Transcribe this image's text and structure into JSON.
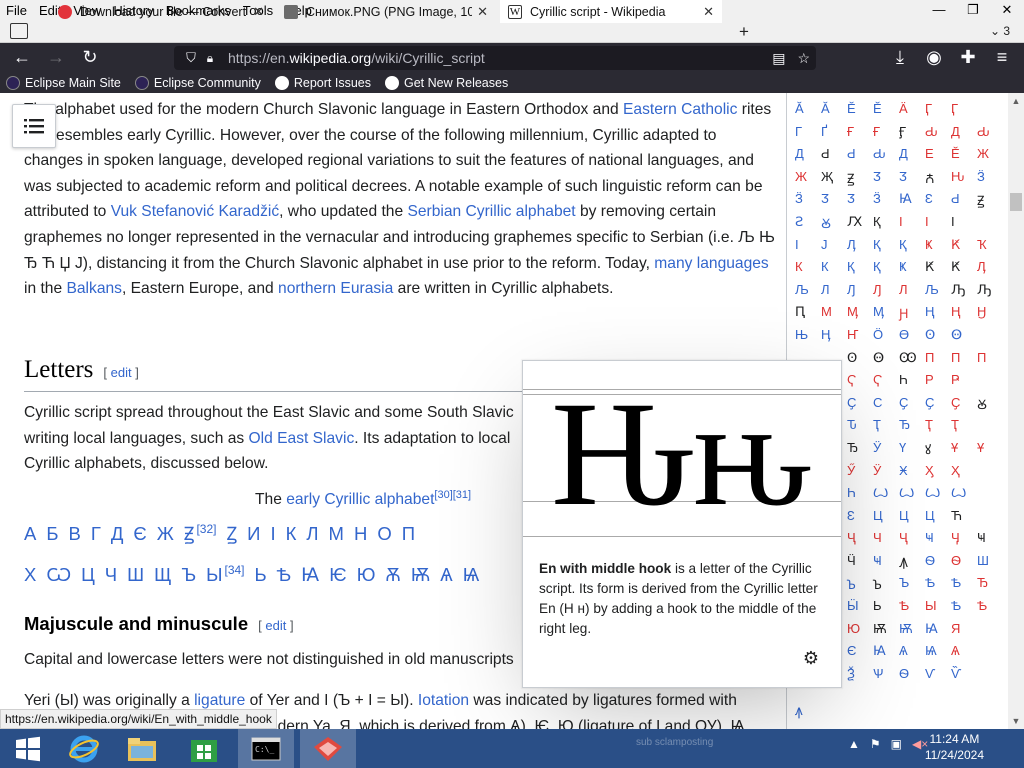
{
  "menubar": {
    "items": [
      "File",
      "Edit",
      "View",
      "History",
      "Bookmarks",
      "Tools",
      "Help"
    ],
    "accels": [
      "F",
      "E",
      "V",
      "s",
      "B",
      "T",
      "H"
    ]
  },
  "window_controls": {
    "minimize": "—",
    "restore": "❐",
    "close": "✕"
  },
  "tabs": [
    {
      "title": "Download your file — Convertic",
      "favicon_color": "#e2333b",
      "close": "✕"
    },
    {
      "title": "Снимок.PNG (PNG Image, 1026",
      "favicon_color": "#6b6b6b",
      "close": "✕"
    },
    {
      "title": "Cyrillic script - Wikipedia",
      "favicon_color": "#ffffff",
      "favicon_glyph": "W",
      "close": "✕"
    }
  ],
  "newtab": "+",
  "tab_count": "⌄ 3",
  "nav": {
    "back": "←",
    "forward": "→",
    "reload": "↻",
    "url_prefix": "https://en.",
    "url_domain": "wikipedia.org",
    "url_path": "/wiki/Cyrillic_script",
    "reader": "▤",
    "star": "☆",
    "download": "⤓",
    "account": "◉",
    "extensions": "✚",
    "menu": "≡"
  },
  "bookmarks": [
    {
      "label": "Eclipse Main Site",
      "icon_color": "#2c2255"
    },
    {
      "label": "Eclipse Community",
      "icon_color": "#2c2255"
    },
    {
      "label": "Report Issues",
      "icon_color": "#ffffff"
    },
    {
      "label": "Get New Releases",
      "icon_color": "#ffffff"
    }
  ],
  "article": {
    "p1": {
      "t1": "The alphabet used for the modern Church Slavonic language in Eastern Orthodox and ",
      "l1": "Eastern Catholic",
      "t2": " rites still resembles early Cyrillic. However, over the course of the following millennium, Cyrillic adapted to changes in spoken language, developed regional variations to suit the features of national languages, and was subjected to academic reform and political decrees. A notable example of such linguistic reform can be attributed to ",
      "l2": "Vuk Stefanović Karadžić",
      "t3": ", who updated the ",
      "l3": "Serbian Cyrillic alphabet",
      "t4": " by removing certain graphemes no longer represented in the vernacular and introducing graphemes specific to Serbian (i.e. Љ Њ Ђ Ћ Џ Ј), distancing it from the Church Slavonic alphabet in use prior to the reform. Today, ",
      "l4": "many languages",
      "t5": " in the ",
      "l5": "Balkans",
      "t6": ", Eastern Europe, and ",
      "l6": "northern Eurasia",
      "t7": " are written in Cyrillic alphabets."
    },
    "h_letters": "Letters",
    "edit_open": "[",
    "edit_label": "edit",
    "edit_close": "]",
    "p2": {
      "t1": "Cyrillic script spread throughout the East Slavic and some South Slavic",
      "t2": "writing local languages, such as ",
      "l1": "Old East Slavic",
      "t3": ". Its adaptation to local",
      "t4": "Cyrillic alphabets, discussed below."
    },
    "caption": {
      "t1": "The ",
      "l1": "early Cyrillic alphabet",
      "ref": "[30][31]"
    },
    "row1": [
      "А",
      "Б",
      "В",
      "Г",
      "Д",
      "Є",
      "Ж",
      "Ꙃ",
      "Ꙁ",
      "И",
      "І",
      "К",
      "Л",
      "М",
      "Н",
      "О",
      "П"
    ],
    "row1_ref": "[32]",
    "row2": [
      "Х",
      "Ѡ",
      "Ц",
      "Ч",
      "Ш",
      "Щ",
      "Ъ",
      "Ы",
      "Ь",
      "Ѣ",
      "Ꙗ",
      "Ѥ",
      "Ю",
      "Ѫ",
      "Ѭ",
      "Ѧ",
      "Ѩ"
    ],
    "row2_ref": "[34]",
    "h_majuscule": "Majuscule and minuscule",
    "p3": "Capital and lowercase letters were not distinguished in old manuscripts",
    "p4": {
      "t1": "Yeri (Ы) was originally a ",
      "l1": "ligature",
      "t2": " of Yer and I (Ъ + І = Ы). ",
      "l2": "Iotation",
      "t3": " was indicated by ligatures formed with",
      "t4": "the letter I: Ꙗ (not an ancestor of modern Ya, Я, which is derived from Ѧ), Ѥ, Ю (ligature of I and ОУ), Ѩ,"
    }
  },
  "chartable": {
    "rows": [
      [
        [
          "Ӑ",
          "b"
        ],
        [
          "Ӑ",
          "b"
        ],
        [
          "Ӗ",
          "b"
        ],
        [
          "Ӗ",
          "b"
        ],
        [
          "Ӓ",
          "r"
        ],
        [
          "Ӷ",
          "r"
        ],
        [
          "Ӷ",
          "r"
        ],
        [
          "",
          ""
        ]
      ],
      [
        [
          "Г",
          "b"
        ],
        [
          "Ґ",
          "b"
        ],
        [
          "Ғ",
          "r"
        ],
        [
          "Ғ",
          "r"
        ],
        [
          "Ӻ",
          "k"
        ],
        [
          "Ԃ",
          "r"
        ],
        [
          "Д",
          "r"
        ],
        [
          "Ԃ",
          "r"
        ]
      ],
      [
        [
          "Д",
          "b"
        ],
        [
          "Ԁ",
          "k"
        ],
        [
          "Ԁ",
          "b"
        ],
        [
          "Ԃ",
          "b"
        ],
        [
          "Д",
          "b"
        ],
        [
          "Е",
          "r"
        ],
        [
          "Ӗ",
          "r"
        ],
        [
          "Ж",
          "r"
        ]
      ],
      [
        [
          "Ж",
          "r"
        ],
        [
          "Җ",
          "k"
        ],
        [
          "Ꙃ",
          "k"
        ],
        [
          "Ӡ",
          "b"
        ],
        [
          "Ӡ",
          "b"
        ],
        [
          "Ꙉ",
          "k"
        ],
        [
          "Ԋ",
          "r"
        ],
        [
          "Ӟ",
          "b"
        ]
      ],
      [
        [
          "Ӟ",
          "b"
        ],
        [
          "Ӡ",
          "b"
        ],
        [
          "Ӡ",
          "b"
        ],
        [
          "Ӟ",
          "b"
        ],
        [
          "Ꙗ",
          "b"
        ],
        [
          "Ԑ",
          "b"
        ],
        [
          "Ԁ",
          "b"
        ],
        [
          "Ꙃ",
          "k"
        ]
      ],
      [
        [
          "Ꙅ",
          "b"
        ],
        [
          "Ꙋ",
          "b"
        ],
        [
          "Ԕ",
          "k"
        ],
        [
          "Қ",
          "k"
        ],
        [
          "Ӏ",
          "r"
        ],
        [
          "Ӏ",
          "r"
        ],
        [
          "Ӏ",
          "k"
        ],
        [
          "",
          ""
        ]
      ],
      [
        [
          "Ӏ",
          "b"
        ],
        [
          "Ј",
          "b"
        ],
        [
          "Ӆ",
          "b"
        ],
        [
          "Қ",
          "b"
        ],
        [
          "Қ",
          "b"
        ],
        [
          "Ҝ",
          "r"
        ],
        [
          "Ԟ",
          "r"
        ],
        [
          "Ҡ",
          "r"
        ]
      ],
      [
        [
          "К",
          "r"
        ],
        [
          "К",
          "b"
        ],
        [
          "Қ",
          "b"
        ],
        [
          "Қ",
          "b"
        ],
        [
          "Ҝ",
          "b"
        ],
        [
          "Ԟ",
          "k"
        ],
        [
          "Ԟ",
          "k"
        ],
        [
          "Ӆ",
          "r"
        ]
      ],
      [
        [
          "Љ",
          "b"
        ],
        [
          "Л",
          "b"
        ],
        [
          "Ԓ",
          "b"
        ],
        [
          "Ԓ",
          "r"
        ],
        [
          "Л",
          "r"
        ],
        [
          "Љ",
          "b"
        ],
        [
          "Ԡ",
          "k"
        ],
        [
          "Ԡ",
          "k"
        ]
      ],
      [
        [
          "Ԥ",
          "k"
        ],
        [
          "М",
          "r"
        ],
        [
          "Ӎ",
          "r"
        ],
        [
          "Ӎ",
          "b"
        ],
        [
          "Ԩ",
          "r"
        ],
        [
          "Ң",
          "b"
        ],
        [
          "Ң",
          "r"
        ],
        [
          "Ӈ",
          "r"
        ]
      ],
      [
        [
          "Њ",
          "b"
        ],
        [
          "Ӊ",
          "b"
        ],
        [
          "Ҥ",
          "r"
        ],
        [
          "Ӧ",
          "b"
        ],
        [
          "Ө",
          "b"
        ],
        [
          "Ꙩ",
          "b"
        ],
        [
          "Ꙫ",
          "b"
        ],
        [
          "",
          ""
        ]
      ],
      [
        [
          "",
          ""
        ],
        [
          "",
          ""
        ],
        [
          "Ꙩ",
          "k"
        ],
        [
          "Ꙫ",
          "k"
        ],
        [
          "Ꙭ",
          "k"
        ],
        [
          "П",
          "r"
        ],
        [
          "П",
          "r"
        ],
        [
          "П",
          "r"
        ]
      ],
      [
        [
          "",
          ""
        ],
        [
          "",
          ""
        ],
        [
          "Ҁ",
          "r"
        ],
        [
          "Ҁ",
          "r"
        ],
        [
          "Һ",
          "k"
        ],
        [
          "Р",
          "r"
        ],
        [
          "Ҏ",
          "r"
        ],
        [
          "",
          ""
        ]
      ],
      [
        [
          "",
          ""
        ],
        [
          "",
          ""
        ],
        [
          "Ҫ",
          "b"
        ],
        [
          "С",
          "b"
        ],
        [
          "Ҫ",
          "b"
        ],
        [
          "Ҫ",
          "b"
        ],
        [
          "Ҫ",
          "r"
        ],
        [
          "Ꙋ",
          "k"
        ]
      ],
      [
        [
          "",
          ""
        ],
        [
          "",
          ""
        ],
        [
          "Ԏ",
          "b"
        ],
        [
          "Ҭ",
          "b"
        ],
        [
          "Ђ",
          "b"
        ],
        [
          "Ҭ",
          "r"
        ],
        [
          "Ҭ",
          "r"
        ],
        [
          "",
          ""
        ]
      ],
      [
        [
          "",
          ""
        ],
        [
          "",
          ""
        ],
        [
          "Ђ",
          "k"
        ],
        [
          "Ӱ",
          "b"
        ],
        [
          "Ү",
          "b"
        ],
        [
          "ꙋ",
          "k"
        ],
        [
          "Ұ",
          "r"
        ],
        [
          "Ұ",
          "r"
        ]
      ],
      [
        [
          "",
          ""
        ],
        [
          "",
          ""
        ],
        [
          "Ӳ",
          "r"
        ],
        [
          "Ӱ",
          "r"
        ],
        [
          "Ӿ",
          "b"
        ],
        [
          "Ӽ",
          "r"
        ],
        [
          "Ҳ",
          "r"
        ],
        [
          "",
          ""
        ]
      ],
      [
        [
          "",
          ""
        ],
        [
          "",
          ""
        ],
        [
          "Һ",
          "b"
        ],
        [
          "Ꙍ",
          "b"
        ],
        [
          "Ꙍ",
          "b"
        ],
        [
          "Ꙍ",
          "b"
        ],
        [
          "Ꙍ",
          "b"
        ],
        [
          "",
          ""
        ]
      ],
      [
        [
          "",
          ""
        ],
        [
          "",
          ""
        ],
        [
          "Ԑ",
          "b"
        ],
        [
          "Ц",
          "b"
        ],
        [
          "Ц",
          "b"
        ],
        [
          "Ц",
          "b"
        ],
        [
          "Ћ",
          "k"
        ],
        [
          "",
          ""
        ]
      ],
      [
        [
          "",
          ""
        ],
        [
          "",
          ""
        ],
        [
          "Ҷ",
          "r"
        ],
        [
          "Ч",
          "r"
        ],
        [
          "Ҷ",
          "r"
        ],
        [
          "Ҹ",
          "b"
        ],
        [
          "Ӌ",
          "r"
        ],
        [
          "Ҹ",
          "k"
        ]
      ],
      [
        [
          "",
          ""
        ],
        [
          "",
          ""
        ],
        [
          "Ӵ",
          "k"
        ],
        [
          "Ҹ",
          "b"
        ],
        [
          "Ꙟ",
          "k"
        ],
        [
          "Ѳ",
          "b"
        ],
        [
          "Ѳ",
          "r"
        ],
        [
          "Ш",
          "b"
        ]
      ],
      [
        [
          "",
          ""
        ],
        [
          "",
          ""
        ],
        [
          "Ꙏ",
          "b"
        ],
        [
          "Ꙏ",
          "k"
        ],
        [
          "Ъ",
          "b"
        ],
        [
          "Ѣ",
          "b"
        ],
        [
          "Ѣ",
          "b"
        ],
        [
          "Ђ",
          "r"
        ]
      ],
      [
        [
          "",
          ""
        ],
        [
          "",
          ""
        ],
        [
          "Ӹ",
          "b"
        ],
        [
          "Ь",
          "k"
        ],
        [
          "Ѣ",
          "r"
        ],
        [
          "Ы",
          "r"
        ],
        [
          "Ѣ",
          "b"
        ],
        [
          "Ѣ",
          "r"
        ]
      ],
      [
        [
          "",
          ""
        ],
        [
          "",
          ""
        ],
        [
          "Ю",
          "r"
        ],
        [
          "Ѭ",
          "k"
        ],
        [
          "Ѭ",
          "b"
        ],
        [
          "Ꙗ",
          "b"
        ],
        [
          "Я",
          "r"
        ],
        [
          "",
          ""
        ]
      ],
      [
        [
          "",
          ""
        ],
        [
          "",
          ""
        ],
        [
          "Є",
          "b"
        ],
        [
          "Ꙗ",
          "b"
        ],
        [
          "Ѧ",
          "b"
        ],
        [
          "Ѩ",
          "b"
        ],
        [
          "Ѧ",
          "r"
        ],
        [
          "",
          ""
        ]
      ],
      [
        [
          "",
          ""
        ],
        [
          "",
          ""
        ],
        [
          "Ѯ",
          "b"
        ],
        [
          "Ѱ",
          "b"
        ],
        [
          "Ѳ",
          "b"
        ],
        [
          "Ѵ",
          "b"
        ],
        [
          "Ѷ",
          "b"
        ],
        [
          "",
          ""
        ]
      ]
    ],
    "bottom_glyph": "ꙟ"
  },
  "popup": {
    "glyph": "Ԋԋ",
    "bold": "En with middle hook",
    "text": " is a letter of the Cyrillic script. Its form is derived from the Cyrillic letter En (Н н) by adding a hook to the middle of the right leg.",
    "settings_icon": "settings-gear"
  },
  "status_url": "https://en.wikipedia.org/wiki/En_with_middle_hook",
  "taskbar": {
    "clock_time": "11:24 AM",
    "clock_date": "11/24/2024",
    "notification_text": "sub sclamposting"
  }
}
